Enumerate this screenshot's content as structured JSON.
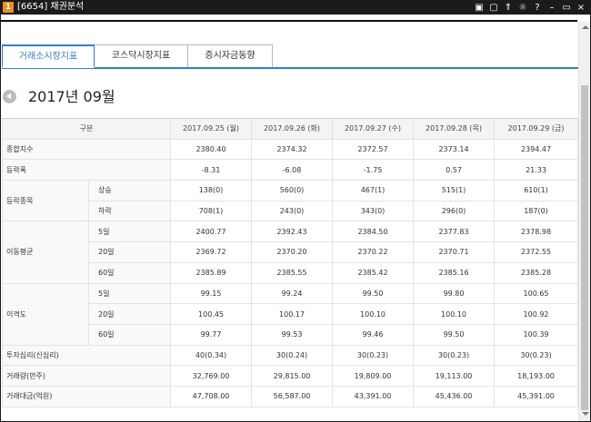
{
  "titlebar": {
    "screen_no": "1",
    "title": "[6654] 채권분석",
    "tools": [
      "▣",
      "▢",
      "⇑",
      "☼",
      "?",
      "–",
      "▭",
      "×"
    ]
  },
  "tabs": [
    {
      "label": "거래소시장지표",
      "active": true
    },
    {
      "label": "코스닥시장지표",
      "active": false
    },
    {
      "label": "증시자금동향",
      "active": false
    }
  ],
  "month_label": "2017년 09월",
  "table": {
    "header": "구분",
    "dates": [
      "2017.09.25 (월)",
      "2017.09.26 (화)",
      "2017.09.27 (수)",
      "2017.09.28 (목)",
      "2017.09.29 (금)"
    ],
    "rows": {
      "composite": {
        "label": "종합지수",
        "values": [
          "2380.40",
          "2374.32",
          "2372.57",
          "2373.14",
          "2394.47"
        ]
      },
      "change": {
        "label": "등락폭",
        "values": [
          "-8.31",
          "-6.08",
          "-1.75",
          "0.57",
          "21.33"
        ]
      },
      "issues": {
        "label": "등락종목",
        "up": {
          "label": "상승",
          "values": [
            "138(0)",
            "560(0)",
            "467(1)",
            "515(1)",
            "610(1)"
          ]
        },
        "down": {
          "label": "하락",
          "values": [
            "708(1)",
            "243(0)",
            "343(0)",
            "296(0)",
            "187(0)"
          ]
        }
      },
      "moving_avg": {
        "label": "이동평균",
        "d5": {
          "label": "5일",
          "values": [
            "2400.77",
            "2392.43",
            "2384.50",
            "2377.83",
            "2378.98"
          ]
        },
        "d20": {
          "label": "20일",
          "values": [
            "2369.72",
            "2370.20",
            "2370.22",
            "2370.71",
            "2372.55"
          ]
        },
        "d60": {
          "label": "60일",
          "values": [
            "2385.89",
            "2385.55",
            "2385.42",
            "2385.16",
            "2385.28"
          ]
        }
      },
      "disparity": {
        "label": "이격도",
        "d5": {
          "label": "5일",
          "values": [
            "99.15",
            "99.24",
            "99.50",
            "99.80",
            "100.65"
          ]
        },
        "d20": {
          "label": "20일",
          "values": [
            "100.45",
            "100.17",
            "100.10",
            "100.10",
            "100.92"
          ]
        },
        "d60": {
          "label": "60일",
          "values": [
            "99.77",
            "99.53",
            "99.46",
            "99.50",
            "100.39"
          ]
        }
      },
      "psychology": {
        "label": "투자심리(신심리)",
        "values": [
          "40(0.34)",
          "30(0.24)",
          "30(0.23)",
          "30(0.23)",
          "30(0.23)"
        ]
      },
      "volume": {
        "label": "거래량(만주)",
        "values": [
          "32,769.00",
          "29,815.00",
          "19,809.00",
          "19,113.00",
          "18,193.00"
        ]
      },
      "amount": {
        "label": "거래대금(억원)",
        "values": [
          "47,708.00",
          "56,587.00",
          "43,391.00",
          "45,436.00",
          "45,391.00"
        ]
      }
    }
  },
  "colors": {
    "accent": "#2f7fd0",
    "titlebar": "#1b1b1b",
    "screen_badge": "#f28c1e"
  }
}
